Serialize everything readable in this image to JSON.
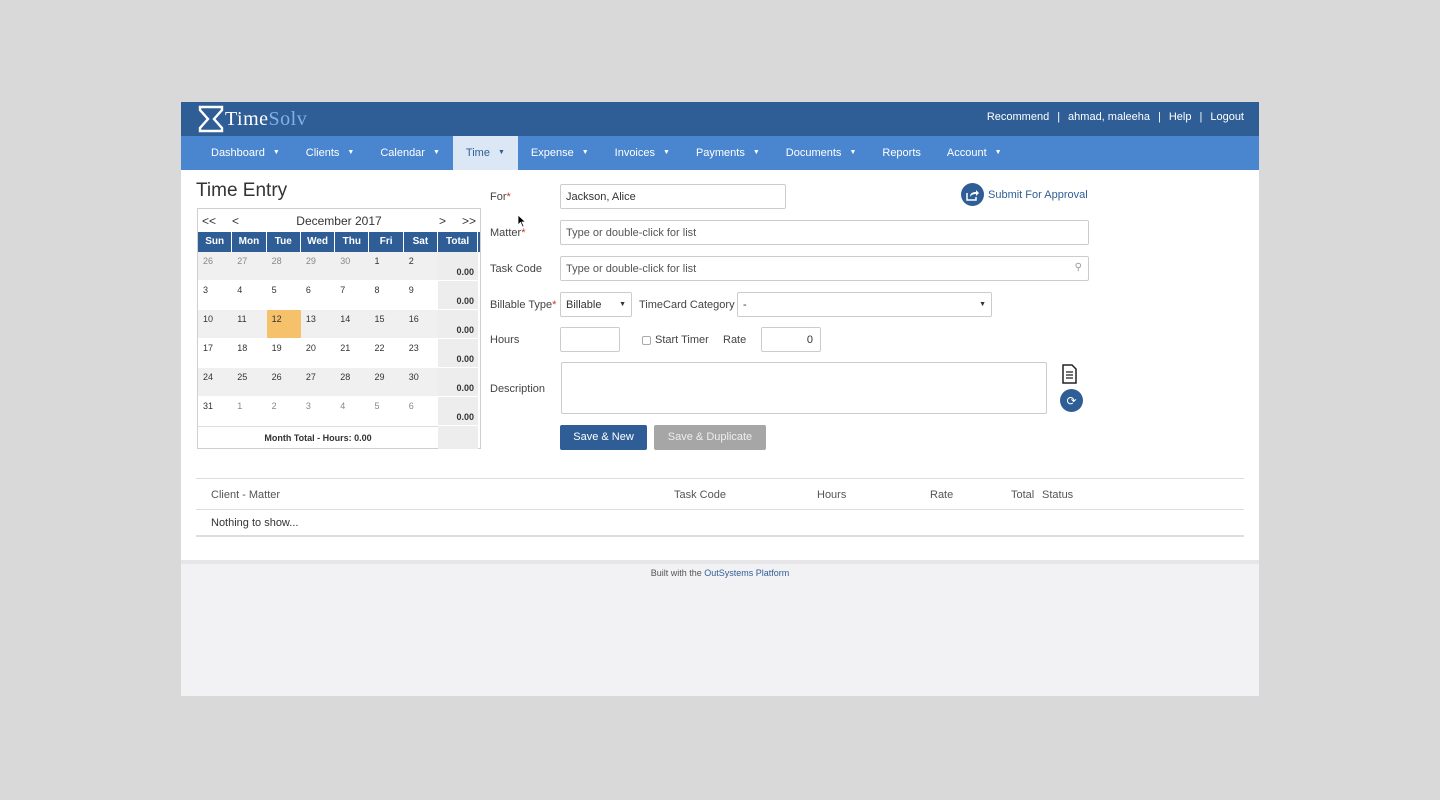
{
  "brand": {
    "part1": "Time",
    "part2": "Solv"
  },
  "top_links": [
    "Recommend",
    "ahmad, maleeha",
    "Help",
    "Logout"
  ],
  "nav": [
    {
      "label": "Dashboard",
      "caret": true
    },
    {
      "label": "Clients",
      "caret": true
    },
    {
      "label": "Calendar",
      "caret": true
    },
    {
      "label": "Time",
      "caret": true,
      "active": true
    },
    {
      "label": "Expense",
      "caret": true
    },
    {
      "label": "Invoices",
      "caret": true
    },
    {
      "label": "Payments",
      "caret": true
    },
    {
      "label": "Documents",
      "caret": true
    },
    {
      "label": "Reports",
      "caret": false
    },
    {
      "label": "Account",
      "caret": true
    }
  ],
  "page_title": "Time Entry",
  "calendar": {
    "first": "<<",
    "prev": "<",
    "next": ">",
    "last": ">>",
    "month": "December 2017",
    "headers": [
      "Sun",
      "Mon",
      "Tue",
      "Wed",
      "Thu",
      "Fri",
      "Sat",
      "Total"
    ],
    "weeks": [
      {
        "days": [
          "26",
          "27",
          "28",
          "29",
          "30",
          "1",
          "2"
        ],
        "other": [
          true,
          true,
          true,
          true,
          true,
          false,
          false
        ],
        "total": "0.00"
      },
      {
        "days": [
          "3",
          "4",
          "5",
          "6",
          "7",
          "8",
          "9"
        ],
        "other": [
          false,
          false,
          false,
          false,
          false,
          false,
          false
        ],
        "total": "0.00"
      },
      {
        "days": [
          "10",
          "11",
          "12",
          "13",
          "14",
          "15",
          "16"
        ],
        "other": [
          false,
          false,
          false,
          false,
          false,
          false,
          false
        ],
        "total": "0.00"
      },
      {
        "days": [
          "17",
          "18",
          "19",
          "20",
          "21",
          "22",
          "23"
        ],
        "other": [
          false,
          false,
          false,
          false,
          false,
          false,
          false
        ],
        "total": "0.00"
      },
      {
        "days": [
          "24",
          "25",
          "26",
          "27",
          "28",
          "29",
          "30"
        ],
        "other": [
          false,
          false,
          false,
          false,
          false,
          false,
          false
        ],
        "total": "0.00"
      },
      {
        "days": [
          "31",
          "1",
          "2",
          "3",
          "4",
          "5",
          "6"
        ],
        "other": [
          false,
          true,
          true,
          true,
          true,
          true,
          true
        ],
        "total": "0.00"
      }
    ],
    "selected_day": "12",
    "month_total": "Month Total - Hours: 0.00"
  },
  "form": {
    "for_label": "For",
    "for_value": "Jackson, Alice",
    "matter_label": "Matter",
    "matter_placeholder": "Type or double-click for list",
    "task_label": "Task Code",
    "task_placeholder": "Type or double-click for list",
    "billable_label": "Billable Type",
    "billable_value": "Billable",
    "timecard_label": "TimeCard Category",
    "timecard_value": "-",
    "hours_label": "Hours",
    "hours_value": "",
    "start_timer_label": "Start Timer",
    "rate_label": "Rate",
    "rate_value": "0",
    "description_label": "Description",
    "description_value": "",
    "save_new": "Save & New",
    "save_duplicate": "Save & Duplicate",
    "submit_approval": "Submit For Approval"
  },
  "table": {
    "headers": [
      "Client - Matter",
      "Task Code",
      "Hours",
      "Rate",
      "Total",
      "Status"
    ],
    "empty": "Nothing to show..."
  },
  "footer": {
    "text": "Built with the",
    "link": "OutSystems Platform"
  },
  "colors": {
    "header": "#2f5e96",
    "nav": "#4a86cf",
    "today": "#f5c26b"
  }
}
